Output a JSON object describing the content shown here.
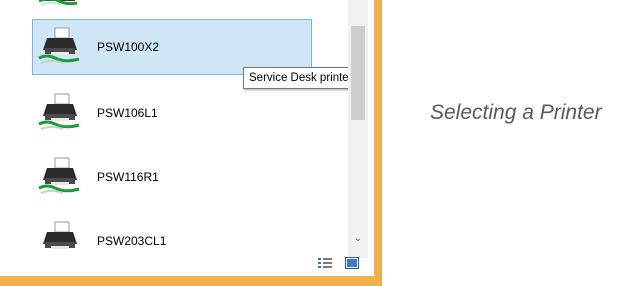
{
  "printers": [
    {
      "name": "",
      "selected": false
    },
    {
      "name": "PSW100X2",
      "selected": true
    },
    {
      "name": "PSW106L1",
      "selected": false
    },
    {
      "name": "PSW116R1",
      "selected": false
    },
    {
      "name": "PSW203CL1",
      "selected": false
    }
  ],
  "tooltip": {
    "text": "Service Desk printer"
  },
  "caption": "Selecting a Printer",
  "icons": {
    "printer": "network-printer-icon",
    "scroll_down": "chevron-down-icon",
    "details_view": "details-view-icon",
    "large_icons_view": "large-icons-view-icon"
  },
  "colors": {
    "selection_background": "#cfe6f7",
    "selection_border": "#7eb4ea",
    "window_frame": "#f2b04b",
    "caption_text": "#595959"
  }
}
